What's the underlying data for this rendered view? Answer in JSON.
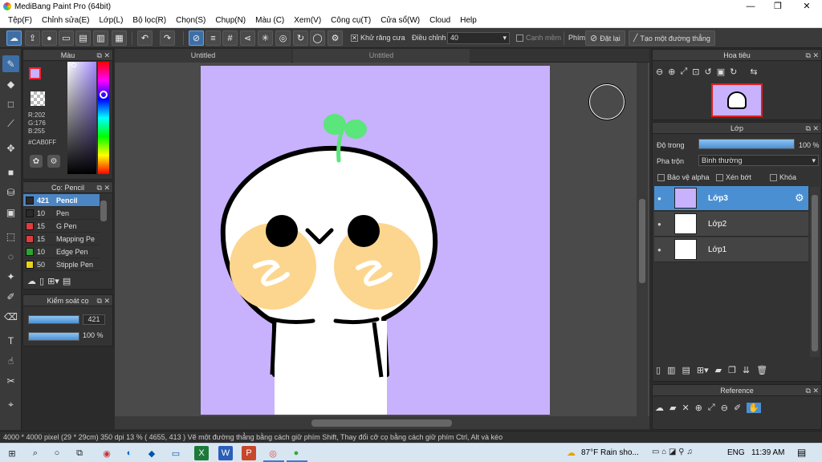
{
  "window": {
    "title": "MediBang Paint Pro (64bit)",
    "minimize": "—",
    "maximize": "❐",
    "close": "✕"
  },
  "menu": [
    "Tệp(F)",
    "Chỉnh sửa(E)",
    "Lớp(L)",
    "Bộ lọc(R)",
    "Chọn(S)",
    "Chụp(N)",
    "Màu (C)",
    "Xem(V)",
    "Công cụ(T)",
    "Cửa sổ(W)",
    "Cloud",
    "Help"
  ],
  "toolbar": {
    "antialias_label": "Khử răng cưa",
    "adjust_label": "Điều chỉnh",
    "adjust_value": "40",
    "soft_edge_label": "Cạnh mềm",
    "key_label": "Phím",
    "reset_label": "Đặt lại",
    "straight_line_label": "Tạo một đường thẳng"
  },
  "color_panel": {
    "title": "Màu",
    "r": "R:202",
    "g": "G:176",
    "b": "B:255",
    "hex": "#CAB0FF",
    "fg_color": "#CAB0FF"
  },
  "brush_panel": {
    "title": "Cọ: Pencil",
    "items": [
      {
        "size": "421",
        "name": "Pencil",
        "color": "#2a2a2a"
      },
      {
        "size": "10",
        "name": "Pen",
        "color": "#2a2a2a"
      },
      {
        "size": "15",
        "name": "G Pen",
        "color": "#e03c3c"
      },
      {
        "size": "15",
        "name": "Mapping Pe",
        "color": "#e03c3c"
      },
      {
        "size": "10",
        "name": "Edge Pen",
        "color": "#2ea32e"
      },
      {
        "size": "50",
        "name": "Stipple Pen",
        "color": "#e8d21a"
      }
    ]
  },
  "brush_control": {
    "title": "Kiểm soát cọ",
    "size_value": "421",
    "opacity_value": "100 %",
    "size_fraction": 1.0,
    "opacity_fraction": 1.0
  },
  "tabs": [
    "Untitled",
    "Untitled"
  ],
  "navigator": {
    "title": "Hoa tiêu"
  },
  "layer_panel": {
    "title": "Lớp",
    "opacity_label": "Độ trong",
    "opacity_value": "100 %",
    "blend_label": "Pha trộn",
    "blend_value": "Bình thường",
    "protect_alpha": "Bảo vệ alpha",
    "clipping": "Xén bớt",
    "lock": "Khóa",
    "layers": [
      "Lớp3",
      "Lớp2",
      "Lớp1"
    ]
  },
  "reference_panel": {
    "title": "Reference"
  },
  "status": "4000 * 4000 pixel   (29 * 29cm)   350 dpi   13 %   ( 4655, 413 )   Vẽ một đường thẳng bằng cách giữ phím Shift, Thay đổi cỡ cọ bằng cách giữ phím Ctrl, Alt và kéo",
  "taskbar": {
    "weather": "87°F  Rain sho...",
    "lang": "ENG",
    "time": "11:39 AM"
  }
}
